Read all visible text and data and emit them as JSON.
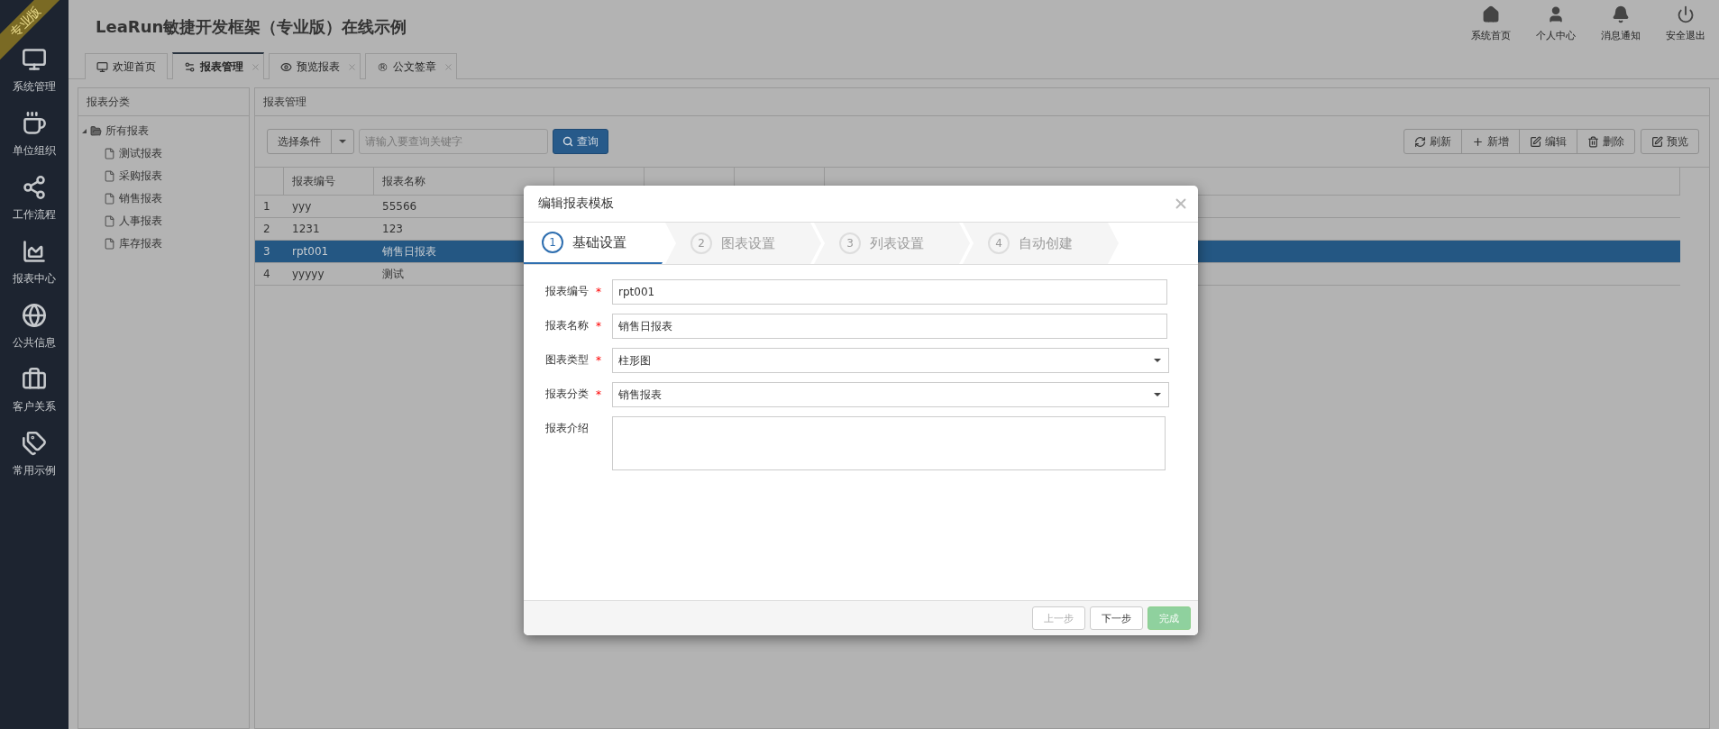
{
  "sidebar": {
    "badge": "专业版",
    "items": [
      {
        "label": "系统管理"
      },
      {
        "label": "单位组织"
      },
      {
        "label": "工作流程"
      },
      {
        "label": "报表中心"
      },
      {
        "label": "公共信息"
      },
      {
        "label": "客户关系"
      },
      {
        "label": "常用示例"
      }
    ]
  },
  "header": {
    "title": "LeaRun敏捷开发框架（专业版）在线示例",
    "actions": [
      {
        "label": "系统首页"
      },
      {
        "label": "个人中心"
      },
      {
        "label": "消息通知"
      },
      {
        "label": "安全退出"
      }
    ]
  },
  "tabs": [
    {
      "label": "欢迎首页",
      "closable": false,
      "selected": false
    },
    {
      "label": "报表管理",
      "closable": true,
      "selected": true
    },
    {
      "label": "预览报表",
      "closable": true,
      "selected": false
    },
    {
      "label": "公文签章",
      "icon_char": "®",
      "closable": true,
      "selected": false
    }
  ],
  "category_panel": {
    "title": "报表分类",
    "tree": [
      {
        "label": "所有报表",
        "expanded": true,
        "children": [
          {
            "label": "测试报表"
          },
          {
            "label": "采购报表"
          },
          {
            "label": "销售报表"
          },
          {
            "label": "人事报表"
          },
          {
            "label": "库存报表"
          }
        ]
      }
    ]
  },
  "report_panel": {
    "title": "报表管理",
    "condition_button": "选择条件",
    "search": {
      "placeholder": "请输入要查询关键字"
    },
    "query_button": "查询",
    "toolbar": [
      {
        "label": "刷新"
      },
      {
        "label": "新增"
      },
      {
        "label": "编辑"
      },
      {
        "label": "删除"
      }
    ],
    "preview_button": {
      "label": "预览"
    },
    "table": {
      "columns": [
        "报表编号",
        "报表名称"
      ],
      "rows": [
        {
          "index": "1",
          "cells": [
            "yyy",
            "55566"
          ],
          "selected": false
        },
        {
          "index": "2",
          "cells": [
            "1231",
            "123"
          ],
          "selected": false
        },
        {
          "index": "3",
          "cells": [
            "rpt001",
            "销售日报表"
          ],
          "selected": true
        },
        {
          "index": "4",
          "cells": [
            "yyyyy",
            "测试"
          ],
          "selected": false
        }
      ]
    }
  },
  "dialog": {
    "title": "编辑报表模板",
    "steps": [
      {
        "number": "1",
        "label": "基础设置",
        "selected": true
      },
      {
        "number": "2",
        "label": "图表设置",
        "selected": false
      },
      {
        "number": "3",
        "label": "列表设置",
        "selected": false
      },
      {
        "number": "4",
        "label": "自动创建",
        "selected": false
      }
    ],
    "fields": [
      {
        "label": "报表编号",
        "required": true,
        "kind": "text",
        "value": "rpt001"
      },
      {
        "label": "报表名称",
        "required": true,
        "kind": "text",
        "value": "销售日报表"
      },
      {
        "label": "图表类型",
        "required": true,
        "kind": "select",
        "value": "柱形图"
      },
      {
        "label": "报表分类",
        "required": true,
        "kind": "select",
        "value": "销售报表"
      },
      {
        "label": "报表介绍",
        "required": false,
        "kind": "textarea"
      }
    ],
    "required_mark": "*",
    "buttons": [
      {
        "label": "上一步",
        "kind": "default",
        "disabled": true
      },
      {
        "label": "下一步",
        "kind": "default",
        "disabled": false
      },
      {
        "label": "完成",
        "kind": "success",
        "disabled": true
      }
    ]
  }
}
